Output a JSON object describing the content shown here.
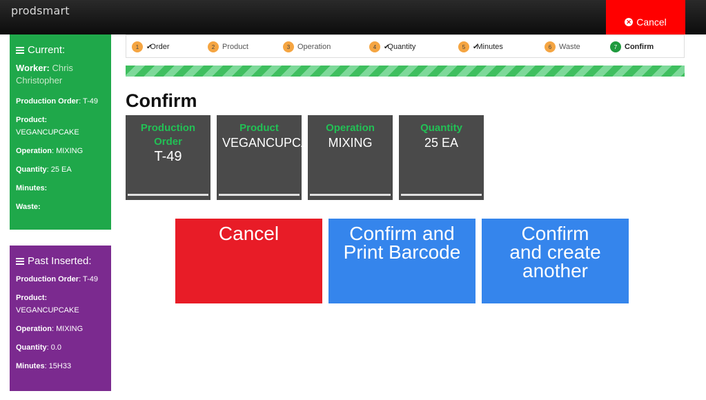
{
  "header": {
    "brand": "prodsmart",
    "cancel_label": "Cancel"
  },
  "current": {
    "title": "Current:",
    "worker_label": "Worker:",
    "worker_value": "Chris Christopher",
    "production_order_label": "Production Order",
    "production_order_value": ": T-49",
    "product_label": "Product:",
    "product_value": "VEGANCUPCAKE",
    "operation_label": "Operation",
    "operation_value": ": MIXING",
    "quantity_label": "Quantity",
    "quantity_value": ": 25 EA",
    "minutes_label": "Minutes:",
    "waste_label": "Waste:"
  },
  "past": {
    "title": "Past Inserted:",
    "production_order_label": "Production Order",
    "production_order_value": ": T-49",
    "product_label": "Product:",
    "product_value": "VEGANCUPCAKE",
    "operation_label": "Operation",
    "operation_value": ": MIXING",
    "quantity_label": "Quantity",
    "quantity_value": ": 0.0",
    "minutes_label": "Minutes",
    "minutes_value": ": 15H33"
  },
  "steps": [
    {
      "num": "1",
      "label": "Order",
      "checked": true
    },
    {
      "num": "2",
      "label": "Product",
      "checked": false
    },
    {
      "num": "3",
      "label": "Operation",
      "checked": false
    },
    {
      "num": "4",
      "label": "Quantity",
      "checked": true
    },
    {
      "num": "5",
      "label": "Minutes",
      "checked": true
    },
    {
      "num": "6",
      "label": "Waste",
      "checked": false
    },
    {
      "num": "7",
      "label": "Confirm",
      "checked": false,
      "active": true
    }
  ],
  "colors": {
    "accent_green": "#1fa84a",
    "purple": "#7b2a8f",
    "danger": "#e81c27",
    "primary": "#3585ec"
  },
  "main": {
    "title": "Confirm",
    "tiles": [
      {
        "label": "Production\nOrder",
        "value": "T-49"
      },
      {
        "label": "Product",
        "value": "VEGANCUPCAKE"
      },
      {
        "label": "Operation",
        "value": "MIXING"
      },
      {
        "label": "Quantity",
        "value": "25 EA"
      }
    ],
    "buttons": {
      "cancel": "Cancel",
      "confirm_print": "Confirm and\nPrint Barcode",
      "confirm_create": "Confirm\nand create\nanother"
    }
  }
}
